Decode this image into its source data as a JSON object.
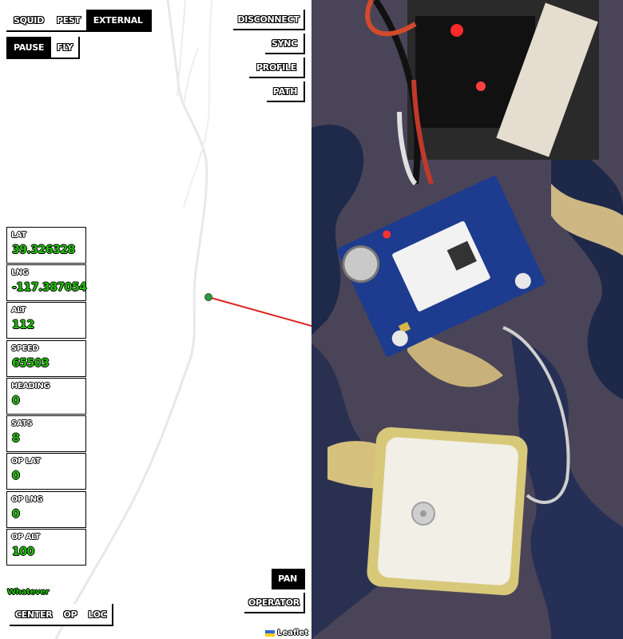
{
  "top_tabs": [
    {
      "label": "Squid",
      "active": false
    },
    {
      "label": "Pest",
      "active": false
    },
    {
      "label": "External",
      "active": true
    }
  ],
  "mode_tabs": [
    {
      "label": "Pause",
      "active": true
    },
    {
      "label": "Fly",
      "active": false
    }
  ],
  "right_buttons": {
    "disconnect": "Disconnect",
    "sync": "Sync",
    "profile": "Profile",
    "path": "Path"
  },
  "telemetry": [
    {
      "label": "LAT",
      "value": "39.326328"
    },
    {
      "label": "LNG",
      "value": "-117.387054"
    },
    {
      "label": "ALT",
      "value": "112"
    },
    {
      "label": "SPEED",
      "value": "65503"
    },
    {
      "label": "HEADING",
      "value": "0"
    },
    {
      "label": "SATS",
      "value": "8"
    },
    {
      "label": "OP LAT",
      "value": "0"
    },
    {
      "label": "OP LNG",
      "value": "0"
    },
    {
      "label": "OP ALT",
      "value": "100"
    }
  ],
  "status_text": "Whatever",
  "bottom_tabs": [
    {
      "label": "Center"
    },
    {
      "label": "OP"
    },
    {
      "label": "LOC"
    }
  ],
  "pan_button": "Pan",
  "operator_button": "Operator",
  "attribution": "Leaflet",
  "colors": {
    "value_green": "#22c20a",
    "track_red": "#e02020",
    "flag_blue": "#2f6bd6",
    "flag_yellow": "#f5cf1a"
  }
}
